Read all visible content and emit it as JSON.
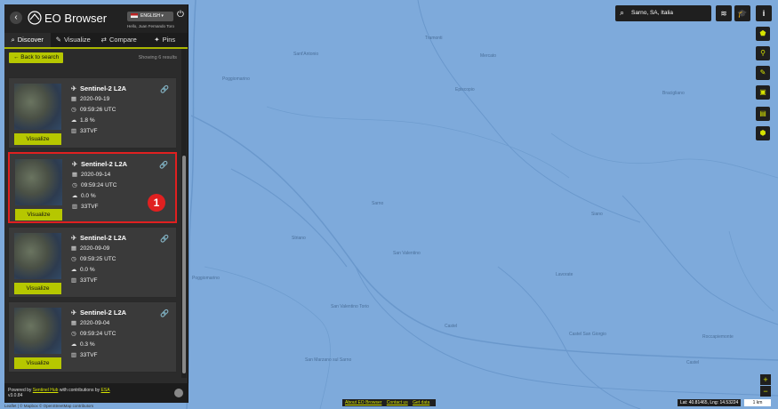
{
  "header": {
    "brand": "EO Browser",
    "language": "ENGLISH",
    "user": "Hello, Juan Fernando Toro"
  },
  "tabs": [
    {
      "label": "Discover",
      "icon": "search-icon",
      "active": true
    },
    {
      "label": "Visualize",
      "icon": "brush-icon",
      "active": false
    },
    {
      "label": "Compare",
      "icon": "compare-icon",
      "active": false
    },
    {
      "label": "Pins",
      "icon": "pin-icon",
      "active": false
    }
  ],
  "subbar": {
    "back_label": "← Back to search",
    "showing": "Showing 6 results"
  },
  "results": [
    {
      "title": "Sentinel-2 L2A",
      "date": "2020-09-19",
      "time": "09:59:26 UTC",
      "cloud": "1.8 %",
      "tile": "33TVF",
      "button": "Visualize",
      "selected": false
    },
    {
      "title": "Sentinel-2 L2A",
      "date": "2020-09-14",
      "time": "09:59:24 UTC",
      "cloud": "0.0 %",
      "tile": "33TVF",
      "button": "Visualize",
      "selected": true
    },
    {
      "title": "Sentinel-2 L2A",
      "date": "2020-09-09",
      "time": "09:59:25 UTC",
      "cloud": "0.0 %",
      "tile": "33TVF",
      "button": "Visualize",
      "selected": false
    },
    {
      "title": "Sentinel-2 L2A",
      "date": "2020-09-04",
      "time": "09:59:24 UTC",
      "cloud": "0.3 %",
      "tile": "33TVF",
      "button": "Visualize",
      "selected": false
    }
  ],
  "annotation": {
    "number": "1"
  },
  "footer": {
    "powered_by": "Powered by",
    "sentinel_hub": "Sentinel Hub",
    "with_contrib": "with contributions by",
    "esa": "ESA",
    "version": "v3.0.84"
  },
  "search": {
    "value": "Sarno, SA, Italia"
  },
  "bottom_links": [
    "About EO Browser",
    "Contact us",
    "Get data"
  ],
  "coords": "Lat: 40.81465, Lng: 14.53224",
  "scale": "1 km",
  "attribution": "Leaflet | © Mapbox © OpenStreetMap contributors",
  "colors": {
    "accent": "#b6c700",
    "panel": "#2b2b2b",
    "map": "#7eaadb",
    "highlight": "#e02020"
  }
}
